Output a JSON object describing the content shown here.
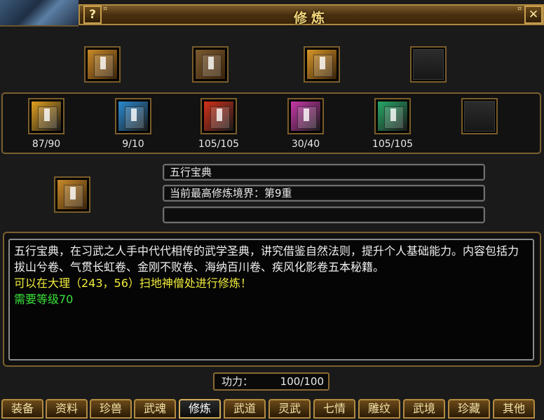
{
  "window": {
    "title": "修炼",
    "help_label": "?",
    "close_label": "✕"
  },
  "techniques": [
    {
      "icon": "wuxing-book-icon",
      "color": "#c98a2a"
    },
    {
      "icon": "scroll-bundle-icon",
      "color": "#7a5a30"
    },
    {
      "icon": "golden-chest-icon",
      "color": "#d8962a"
    },
    {
      "icon": "empty-slot-icon",
      "color": "#222222"
    }
  ],
  "volumes": [
    {
      "icon": "yellow-book-icon",
      "color": "#e0a020",
      "count": "87/90"
    },
    {
      "icon": "blue-book-icon",
      "color": "#2a8ad0",
      "count": "9/10"
    },
    {
      "icon": "red-book-icon",
      "color": "#d23018",
      "count": "105/105"
    },
    {
      "icon": "pink-book-icon",
      "color": "#c838a8",
      "count": "30/40"
    },
    {
      "icon": "green-book-icon",
      "color": "#28a868",
      "count": "105/105"
    },
    {
      "icon": "empty-slot-icon",
      "color": "#222222",
      "count": ""
    }
  ],
  "selected": {
    "icon": "wuxing-book-icon",
    "name": "五行宝典",
    "realm": "当前最高修炼境界：第9重",
    "extra": ""
  },
  "description": {
    "text": "五行宝典，在习武之人手中代代相传的武学圣典，讲究借鉴自然法则，提升个人基础能力。内容包括力拔山兮卷、气贯长虹卷、金刚不败卷、海纳百川卷、疾风化影卷五本秘籍。",
    "location": "可以在大理（243，56）扫地神僧处进行修炼！",
    "requirement": "需要等级70"
  },
  "power": {
    "label": "功力：",
    "value": "100/100"
  },
  "tabs": [
    "装备",
    "资料",
    "珍兽",
    "武魂",
    "修炼",
    "武道",
    "灵武",
    "七情",
    "雕纹",
    "武境",
    "珍藏",
    "其他"
  ],
  "active_tab": "修炼"
}
